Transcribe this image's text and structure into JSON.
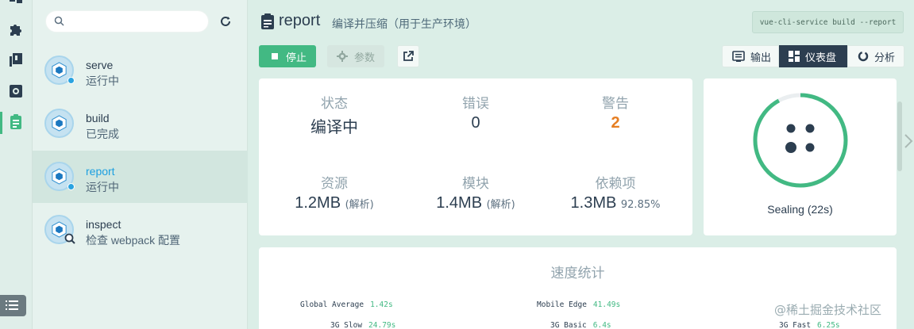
{
  "rail": {
    "icons": [
      "dashboard-icon",
      "puzzle-icon",
      "dependencies-icon",
      "settings-icon",
      "tasks-icon"
    ],
    "bottom_icon": "list-icon"
  },
  "tasks_panel": {
    "search_placeholder": "",
    "items": [
      {
        "name": "serve",
        "status": "运行中"
      },
      {
        "name": "build",
        "status": "已完成"
      },
      {
        "name": "report",
        "status": "运行中"
      },
      {
        "name": "inspect",
        "status": "检查 webpack 配置"
      }
    ]
  },
  "header": {
    "title": "report",
    "description": "编译并压缩（用于生产环境）",
    "command": "vue-cli-service build --report"
  },
  "toolbar": {
    "stop_label": "停止",
    "params_label": "参数",
    "views": {
      "output": "输出",
      "dashboard": "仪表盘",
      "analyze": "分析"
    }
  },
  "stats": {
    "status": {
      "label": "状态",
      "value": "编译中"
    },
    "errors": {
      "label": "错误",
      "value": "0"
    },
    "warnings": {
      "label": "警告",
      "value": "2"
    },
    "assets": {
      "label": "资源",
      "value": "1.2MB",
      "note": "(解析)"
    },
    "modules": {
      "label": "模块",
      "value": "1.4MB",
      "note": "(解析)"
    },
    "deps": {
      "label": "依赖项",
      "value": "1.3MB",
      "note": "92.85%"
    }
  },
  "progress": {
    "label": "Sealing (22s)",
    "fraction": 0.92
  },
  "speed": {
    "title": "速度统计",
    "rows": [
      {
        "name": "Global Average",
        "value": "1.42s"
      },
      {
        "name": "Mobile Edge",
        "value": "41.49s"
      },
      {
        "name": "3G Slow",
        "value": "24.79s"
      },
      {
        "name": "3G Basic",
        "value": "6.4s"
      },
      {
        "name": "3G Fast",
        "value": "6.25s"
      }
    ]
  },
  "watermark": "@稀土掘金技术社区",
  "colors": {
    "accent": "#42b983",
    "warning": "#e67e22",
    "dark": "#2c3e50",
    "link": "#1c9fe0"
  }
}
